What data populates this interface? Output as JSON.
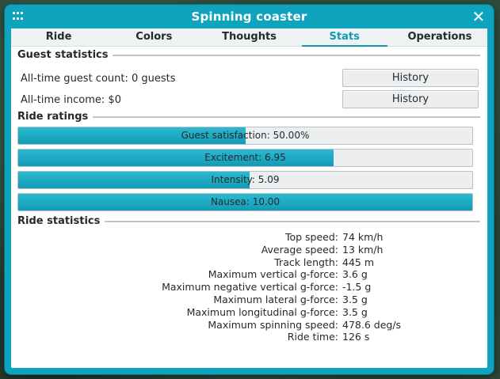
{
  "window": {
    "title": "Spinning coaster"
  },
  "tabs": [
    "Ride",
    "Colors",
    "Thoughts",
    "Stats",
    "Operations"
  ],
  "active_tab": "Stats",
  "guest_statistics": {
    "heading": "Guest statistics",
    "guest_count_label": "All-time guest count: 0 guests",
    "income_label": "All-time income: $0",
    "history_button_1": "History",
    "history_button_2": "History"
  },
  "ride_ratings": {
    "heading": "Ride ratings",
    "bars": [
      {
        "label": "Guest satisfaction: 50.00%",
        "fraction": 0.5
      },
      {
        "label": "Excitement: 6.95",
        "fraction": 0.695
      },
      {
        "label": "Intensity: 5.09",
        "fraction": 0.509
      },
      {
        "label": "Nausea: 10.00",
        "fraction": 1.0
      }
    ]
  },
  "ride_statistics": {
    "heading": "Ride statistics",
    "rows": [
      {
        "key": "Top speed:",
        "value": "74 km/h"
      },
      {
        "key": "Average speed:",
        "value": "13 km/h"
      },
      {
        "key": "Track length:",
        "value": "445 m"
      },
      {
        "key": "Maximum vertical g-force:",
        "value": "3.6 g"
      },
      {
        "key": "Maximum negative vertical g-force:",
        "value": "-1.5 g"
      },
      {
        "key": "Maximum lateral g-force:",
        "value": "3.5 g"
      },
      {
        "key": "Maximum longitudinal g-force:",
        "value": "3.5 g"
      },
      {
        "key": "Maximum spinning speed:",
        "value": "478.6 deg/s"
      },
      {
        "key": "Ride time:",
        "value": "126 s"
      }
    ]
  },
  "colors": {
    "accent": "#0fa3bd",
    "bar_fill": "#139bb5",
    "panel": "#ffffff"
  },
  "icons": {
    "grip": "drag-grip-icon",
    "close": "close-icon"
  }
}
